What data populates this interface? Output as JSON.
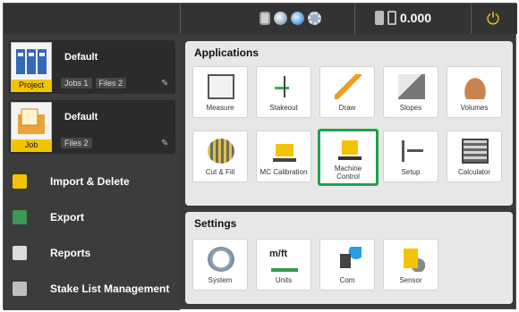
{
  "topbar": {
    "status_value": "0.000",
    "icons": [
      "battery-icon",
      "gnss-ball-icon",
      "radio-ball-icon",
      "settings-gear-icon"
    ],
    "power_icon": "power-icon"
  },
  "left": {
    "project": {
      "title": "Default",
      "label": "Project",
      "jobs_chip": "Jobs 1",
      "files_chip": "Files 2"
    },
    "job": {
      "title": "Default",
      "label": "Job",
      "files_chip": "Files 2"
    },
    "menu": [
      {
        "label": "Import & Delete",
        "icon": "import-delete-icon"
      },
      {
        "label": "Export",
        "icon": "export-icon"
      },
      {
        "label": "Reports",
        "icon": "reports-icon"
      },
      {
        "label": "Stake List Management",
        "icon": "stake-list-icon"
      }
    ]
  },
  "applications": {
    "title": "Applications",
    "tiles": [
      {
        "label": "Measure"
      },
      {
        "label": "Stakeout"
      },
      {
        "label": "Draw"
      },
      {
        "label": "Slopes"
      },
      {
        "label": "Volumes"
      },
      {
        "label": "Cut & Fill"
      },
      {
        "label": "MC Calibration"
      },
      {
        "label": "Machine Control",
        "selected": true
      },
      {
        "label": "Setup"
      },
      {
        "label": "Calculator"
      }
    ]
  },
  "settings": {
    "title": "Settings",
    "units_glyph": "m/ft",
    "tiles": [
      {
        "label": "System"
      },
      {
        "label": "Units"
      },
      {
        "label": "Com"
      },
      {
        "label": "Sensor"
      }
    ]
  },
  "colors": {
    "accent_yellow": "#f3c300",
    "selection_green": "#1aa34a",
    "dark_bg": "#3a3a3a"
  }
}
